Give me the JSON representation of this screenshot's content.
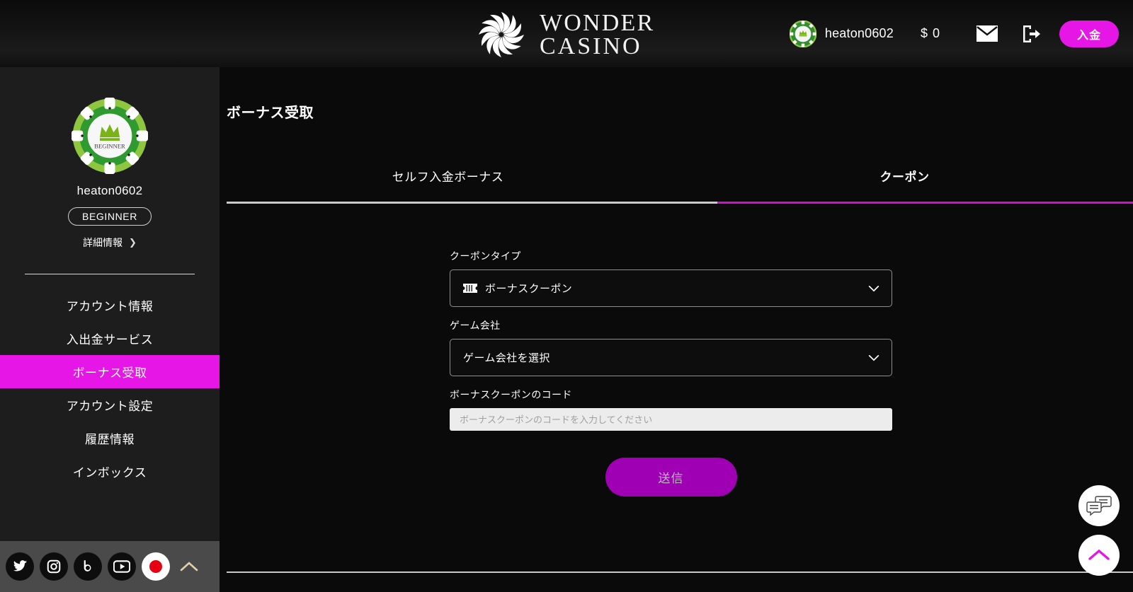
{
  "header": {
    "logo_line1": "WONDER",
    "logo_line2": "CASINO",
    "logo_icon": "wonder-spiral-logo",
    "username": "heaton0602",
    "balance": "$ 0",
    "mail_icon": "envelope-icon",
    "logout_icon": "logout-icon",
    "deposit_label": "入金",
    "accent_color": "#e617e6"
  },
  "sidebar": {
    "avatar_icon": "beginner-chip-avatar",
    "username": "heaton0602",
    "rank_label": "BEGINNER",
    "detail_label": "詳細情報",
    "detail_chevron": "chevron-right-icon",
    "items": [
      {
        "label": "アカウント情報",
        "active": false
      },
      {
        "label": "入出金サービス",
        "active": false
      },
      {
        "label": "ボーナス受取",
        "active": true
      },
      {
        "label": "アカウント設定",
        "active": false
      },
      {
        "label": "履歴情報",
        "active": false
      },
      {
        "label": "インボックス",
        "active": false
      }
    ],
    "social": [
      {
        "name": "twitter-icon"
      },
      {
        "name": "instagram-icon"
      },
      {
        "name": "bebo-icon"
      },
      {
        "name": "youtube-icon"
      },
      {
        "name": "japan-flag-icon"
      }
    ],
    "collapse_icon": "chevron-up-icon"
  },
  "main": {
    "page_title": "ボーナス受取",
    "tabs": [
      {
        "label": "セルフ入金ボーナス",
        "active": false
      },
      {
        "label": "クーポン",
        "active": true
      }
    ],
    "form": {
      "coupon_type_label": "クーポンタイプ",
      "coupon_type_value": "ボーナスクーポン",
      "coupon_type_icon": "ticket-icon",
      "game_company_label": "ゲーム会社",
      "game_company_value": "ゲーム会社を選択",
      "coupon_code_label": "ボーナスクーポンのコード",
      "coupon_code_value": "",
      "coupon_code_placeholder": "ボーナスクーポンのコードを入力してください",
      "submit_label": "送信"
    }
  },
  "floating": {
    "chat_icon": "chat-bubbles-icon",
    "scroll_top_icon": "chevron-up-icon"
  }
}
